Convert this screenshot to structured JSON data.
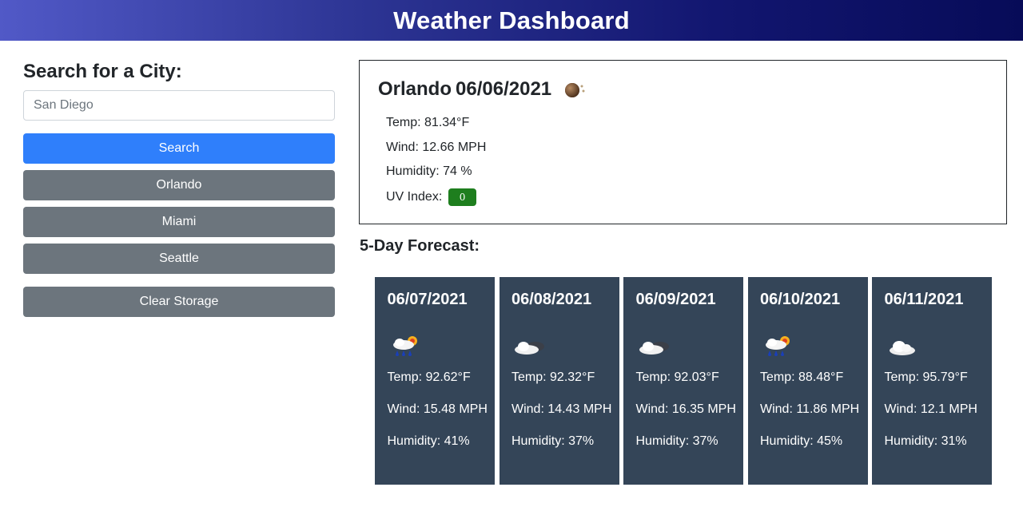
{
  "header": {
    "title": "Weather Dashboard"
  },
  "sidebar": {
    "heading": "Search for a City:",
    "search_placeholder": "San Diego",
    "search_value": "",
    "search_button": "Search",
    "history": [
      "Orlando",
      "Miami",
      "Seattle"
    ],
    "clear_button": "Clear Storage"
  },
  "current": {
    "city": "Orlando",
    "date": "06/06/2021",
    "icon": "rain-sun-icon",
    "temp": "Temp: 81.34°F",
    "wind": "Wind: 12.66 MPH",
    "humidity": "Humidity: 74 %",
    "uv_label": "UV Index:",
    "uv_value": "0",
    "uv_color": "#1e7e1e"
  },
  "forecast": {
    "title": "5-Day Forecast:",
    "days": [
      {
        "date": "06/07/2021",
        "icon": "rain-sun-icon",
        "temp": "Temp: 92.62°F",
        "wind": "Wind: 15.48 MPH",
        "humidity": "Humidity: 41%"
      },
      {
        "date": "06/08/2021",
        "icon": "cloudy-icon",
        "temp": "Temp: 92.32°F",
        "wind": "Wind: 14.43 MPH",
        "humidity": "Humidity: 37%"
      },
      {
        "date": "06/09/2021",
        "icon": "cloudy-icon",
        "temp": "Temp: 92.03°F",
        "wind": "Wind: 16.35 MPH",
        "humidity": "Humidity: 37%"
      },
      {
        "date": "06/10/2021",
        "icon": "rain-sun-icon",
        "temp": "Temp: 88.48°F",
        "wind": "Wind: 11.86 MPH",
        "humidity": "Humidity: 45%"
      },
      {
        "date": "06/11/2021",
        "icon": "cloud-icon",
        "temp": "Temp: 95.79°F",
        "wind": "Wind: 12.1 MPH",
        "humidity": "Humidity: 31%"
      }
    ]
  },
  "colors": {
    "primary_button": "#2f7ffb",
    "secondary_button": "#6c757d",
    "forecast_card": "#344558"
  }
}
